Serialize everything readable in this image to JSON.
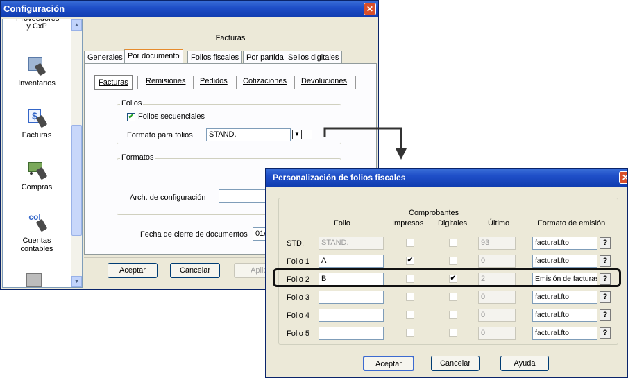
{
  "config_window": {
    "title": "Configuración",
    "sidebar": {
      "items": [
        {
          "label": "Proveedores y CxP",
          "icon": "suppliers-icon"
        },
        {
          "label": "Inventarios",
          "icon": "inventory-icon"
        },
        {
          "label": "Facturas",
          "icon": "invoice-icon"
        },
        {
          "label": "Compras",
          "icon": "purchases-icon"
        },
        {
          "label": "Cuentas contables",
          "icon": "accounts-icon"
        }
      ]
    },
    "header": "Facturas",
    "tabs": [
      "Generales",
      "Por documento",
      "Folios fiscales",
      "Por partida",
      "Sellos digitales"
    ],
    "subtabs": [
      "Facturas",
      "Remisiones",
      "Pedidos",
      "Cotizaciones",
      "Devoluciones"
    ],
    "folios_group": {
      "title": "Folios",
      "checkbox_label": "Folios secuenciales",
      "checked": true,
      "format_label": "Formato para folios",
      "format_value": "STAND."
    },
    "formatos_group": {
      "title": "Formatos",
      "config_label": "Arch. de configuración",
      "config_value": ""
    },
    "closing_date_label": "Fecha de cierre de documentos",
    "closing_date_value": "01/",
    "buttons": {
      "accept": "Aceptar",
      "cancel": "Cancelar",
      "apply": "Aplic"
    }
  },
  "folios_dialog": {
    "title": "Personalización de folios fiscales",
    "headers": {
      "folio": "Folio",
      "comprobantes": "Comprobantes",
      "impresos": "Impresos",
      "digitales": "Digitales",
      "ultimo": "Último",
      "formato": "Formato de emisión"
    },
    "rows": [
      {
        "label": "STD.",
        "folio": "STAND.",
        "impresos": false,
        "digitales": false,
        "ultimo": "93",
        "formato": "factural.fto",
        "folio_disabled": true
      },
      {
        "label": "Folio 1",
        "folio": "A",
        "impresos": true,
        "digitales": false,
        "ultimo": "0",
        "formato": "factural.fto",
        "folio_disabled": false
      },
      {
        "label": "Folio 2",
        "folio": "B",
        "impresos": false,
        "digitales": true,
        "ultimo": "2",
        "formato": "Emisión de facturas",
        "folio_disabled": false
      },
      {
        "label": "Folio 3",
        "folio": "",
        "impresos": false,
        "digitales": false,
        "ultimo": "0",
        "formato": "factural.fto",
        "folio_disabled": false
      },
      {
        "label": "Folio 4",
        "folio": "",
        "impresos": false,
        "digitales": false,
        "ultimo": "0",
        "formato": "factural.fto",
        "folio_disabled": false
      },
      {
        "label": "Folio 5",
        "folio": "",
        "impresos": false,
        "digitales": false,
        "ultimo": "0",
        "formato": "factural.fto",
        "folio_disabled": false
      }
    ],
    "help_glyph": "?",
    "buttons": {
      "accept": "Aceptar",
      "cancel": "Cancelar",
      "help": "Ayuda"
    }
  }
}
